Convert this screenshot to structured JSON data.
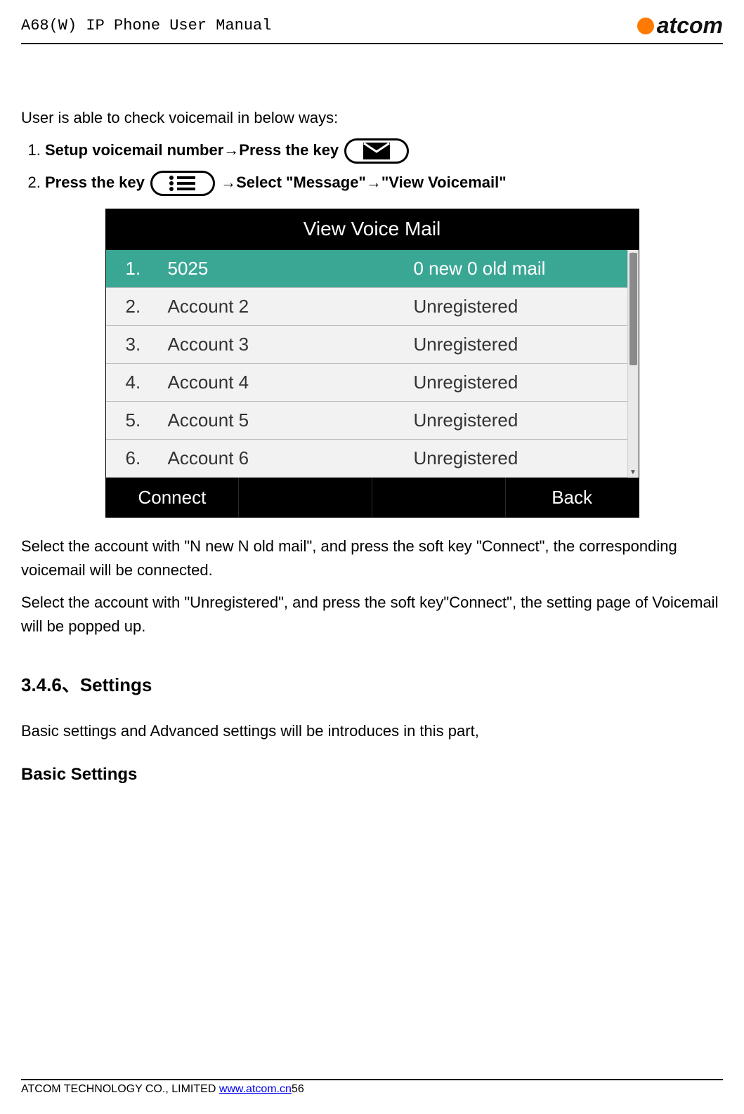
{
  "header": {
    "doc_title": "A68(W) IP Phone User Manual",
    "brand": "atcom"
  },
  "body": {
    "intro": "User is able to check voicemail in below ways:",
    "step1_a": "Setup voicemail number→Press the key",
    "step2_a": "Press the key",
    "step2_b": "→Select \"Message\"→\"View Voicemail\"",
    "screen_title": "View Voice Mail",
    "rows": [
      {
        "idx": "1.",
        "name": "5025",
        "status": "0 new 0 old mail"
      },
      {
        "idx": "2.",
        "name": "Account 2",
        "status": "Unregistered"
      },
      {
        "idx": "3.",
        "name": "Account 3",
        "status": "Unregistered"
      },
      {
        "idx": "4.",
        "name": "Account 4",
        "status": "Unregistered"
      },
      {
        "idx": "5.",
        "name": "Account 5",
        "status": "Unregistered"
      },
      {
        "idx": "6.",
        "name": "Account 6",
        "status": "Unregistered"
      }
    ],
    "softkeys": {
      "sk1": "Connect",
      "sk2": "",
      "sk3": "",
      "sk4": "Back"
    },
    "para_after_1": "Select the account with \"N new N old mail\", and press the soft key \"Connect\", the corresponding voicemail will be connected.",
    "para_after_2": "Select the account with \"Unregistered\", and press the soft key\"Connect\", the setting page of Voicemail will be popped up.",
    "settings_heading": "3.4.6、Settings",
    "settings_intro": "Basic settings and Advanced settings will be introduces in this part,",
    "basic_heading": "Basic Settings"
  },
  "footer": {
    "company": "ATCOM TECHNOLOGY CO., LIMITED ",
    "url": "www.atcom.cn",
    "page_no": "56"
  }
}
